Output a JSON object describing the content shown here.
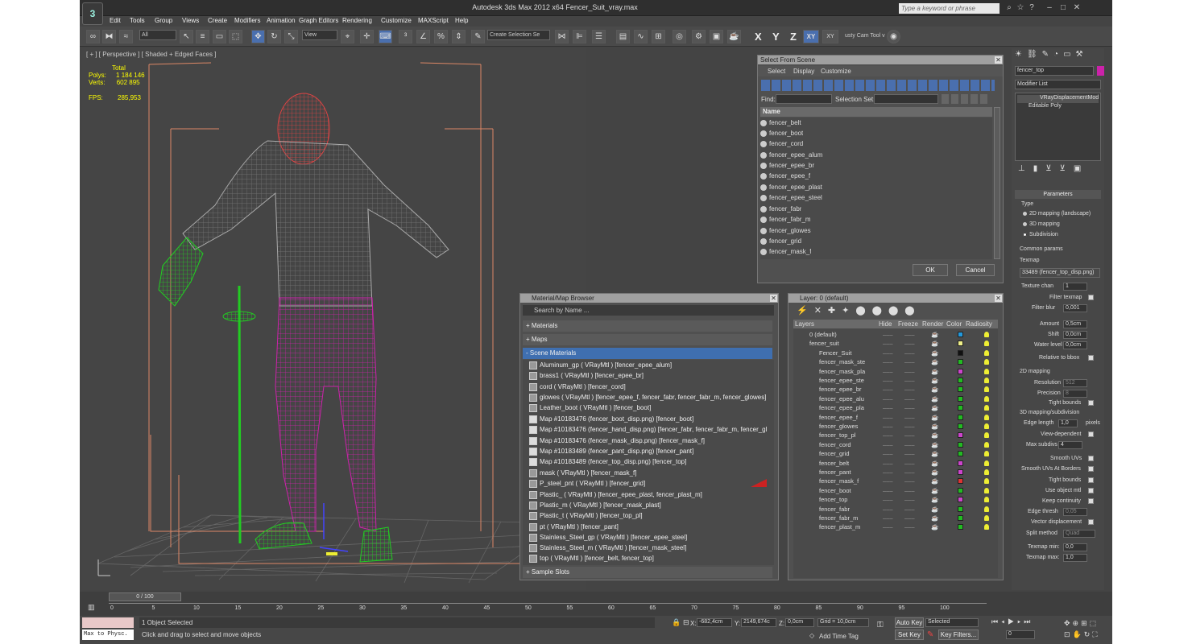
{
  "app": {
    "title": "Autodesk 3ds Max  2012 x64     Fencer_Suit_vray.max",
    "search_placeholder": "Type a keyword or phrase"
  },
  "menu": [
    "Edit",
    "Tools",
    "Group",
    "Views",
    "Create",
    "Modifiers",
    "Animation",
    "Graph Editors",
    "Rendering",
    "Customize",
    "MAXScript",
    "Help"
  ],
  "toolbar": {
    "filter": "All",
    "refcoord": "View",
    "named_sel": "Create Selection Se",
    "axes": [
      "X",
      "Y",
      "Z",
      "XY"
    ],
    "plugin": "usty Cam Tool v"
  },
  "viewport": {
    "label": "[ + ] [ Perspective ] [ Shaded + Edged Faces ]",
    "stats": {
      "total_label": "Total",
      "polys_label": "Polys:",
      "polys": "1 184 146",
      "verts_label": "Verts:",
      "verts": "602 895",
      "fps_label": "FPS:",
      "fps": "285,953"
    }
  },
  "select_from_scene": {
    "title": "Select From Scene",
    "menu": [
      "Select",
      "Display",
      "Customize"
    ],
    "find_label": "Find:",
    "selset_label": "Selection Set:",
    "col_name": "Name",
    "items": [
      "fencer_belt",
      "fencer_boot",
      "fencer_cord",
      "fencer_epee_alum",
      "fencer_epee_br",
      "fencer_epee_f",
      "fencer_epee_plast",
      "fencer_epee_steel",
      "fencer_fabr",
      "fencer_fabr_m",
      "fencer_glowes",
      "fencer_grid",
      "fencer_mask_f"
    ],
    "ok": "OK",
    "cancel": "Cancel"
  },
  "material_browser": {
    "title": "Material/Map Browser",
    "search": "Search by Name ...",
    "sections": [
      "+ Materials",
      "+ Maps",
      "- Scene Materials",
      "+ Sample Slots"
    ],
    "materials": [
      "Aluminum_gp  ( VRayMtl )  [fencer_epee_alum]",
      "brass1  ( VRayMtl )  [fencer_epee_br]",
      "cord  ( VRayMtl )  [fencer_cord]",
      "glowes  ( VRayMtl )  [fencer_epee_f, fencer_fabr, fencer_fabr_m, fencer_glowes]",
      "Leather_boot  ( VRayMtl )  [fencer_boot]",
      "Map #10183476 (fencer_boot_disp.png)  [fencer_boot]",
      "Map #10183476 (fencer_hand_disp.png)  [fencer_fabr, fencer_fabr_m, fencer_gl...",
      "Map #10183476 (fencer_mask_disp.png)  [fencer_mask_f]",
      "Map #10183489 (fencer_pant_disp.png)  [fencer_pant]",
      "Map #10183489 (fencer_top_disp.png)  [fencer_top]",
      "mask  ( VRayMtl )  [fencer_mask_f]",
      "P_steel_pnt  ( VRayMtl )  [fencer_grid]",
      "Plastic_  ( VRayMtl )  [fencer_epee_plast, fencer_plast_m]",
      "Plastic_m  ( VRayMtl )  [fencer_mask_plast]",
      "Plastic_t  ( VRayMtl )  [fencer_top_pl]",
      "pt  ( VRayMtl )  [fencer_pant]",
      "Stainless_Steel_gp  ( VRayMtl )  [fencer_epee_steel]",
      "Stainless_Steel_m  ( VRayMtl )  [fencer_mask_steel]",
      "top  ( VRayMtl )  [fencer_belt, fencer_top]"
    ]
  },
  "layer_panel": {
    "title": "Layer: 0 (default)",
    "headers": [
      "Layers",
      "Hide",
      "Freeze",
      "Render",
      "Color",
      "Radiosity"
    ],
    "rows": [
      {
        "name": "0 (default)",
        "color": "#2299dd"
      },
      {
        "name": "fencer_suit",
        "color": "#eeee88"
      },
      {
        "name": "Fencer_Suit",
        "color": "#111111"
      },
      {
        "name": "fencer_mask_ste",
        "color": "#22bb22"
      },
      {
        "name": "fencer_mask_pla",
        "color": "#cc44cc"
      },
      {
        "name": "fencer_epee_ste",
        "color": "#22bb22"
      },
      {
        "name": "fencer_epee_br",
        "color": "#22bb22"
      },
      {
        "name": "fencer_epee_alu",
        "color": "#22bb22"
      },
      {
        "name": "fencer_epee_pla",
        "color": "#22bb22"
      },
      {
        "name": "fencer_epee_f",
        "color": "#22bb22"
      },
      {
        "name": "fencer_glowes",
        "color": "#22bb22"
      },
      {
        "name": "fencer_top_pl",
        "color": "#cc44cc"
      },
      {
        "name": "fencer_cord",
        "color": "#22bb22"
      },
      {
        "name": "fencer_grid",
        "color": "#22bb22"
      },
      {
        "name": "fencer_belt",
        "color": "#cc44cc"
      },
      {
        "name": "fencer_pant",
        "color": "#cc44cc"
      },
      {
        "name": "fencer_mask_f",
        "color": "#dd3333"
      },
      {
        "name": "fencer_boot",
        "color": "#22bb22"
      },
      {
        "name": "fencer_top",
        "color": "#cc44cc"
      },
      {
        "name": "fencer_fabr",
        "color": "#22bb22"
      },
      {
        "name": "fencer_fabr_m",
        "color": "#22bb22"
      },
      {
        "name": "fencer_plast_m",
        "color": "#22bb22"
      }
    ]
  },
  "command_panel": {
    "object_name": "fencer_top",
    "modifier_list": "Modifier List",
    "stack": [
      "VRayDisplacementMod",
      "Editable Poly"
    ],
    "rollout": "Parameters",
    "type_label": "Type",
    "types": [
      "2D mapping (landscape)",
      "3D mapping",
      "Subdivision"
    ],
    "common": "Common params",
    "texmap_label": "Texmap",
    "texmap": "33489 (fencer_top_disp.png)",
    "texture_chan": "1",
    "filter_texmap": "Filter texmap",
    "filter_blur": "0,001",
    "amount": "0,5cm",
    "shift": "0,0cm",
    "water_level": "0,0cm",
    "relative_bbox": "Relative to bbox",
    "mapping2d": "2D mapping",
    "resolution": "512",
    "precision": "8",
    "tight_bounds": "Tight bounds",
    "mapping3d": "3D mapping/subdivision",
    "edge_length": "1,0",
    "pixels": "pixels",
    "view_dependent": "View-dependent",
    "max_subdivs": "4",
    "smooth_uvs": "Smooth UVs",
    "smooth_uvs_borders": "Smooth UVs At Borders",
    "tight_bounds2": "Tight bounds",
    "use_object_mtl": "Use object mtl",
    "keep_continuity": "Keep continuity",
    "edge_thresh": "0,05",
    "vector_disp": "Vector displacement",
    "split_method": "Quad",
    "texmap_min": "0,0",
    "texmap_max": "1,0",
    "labels": {
      "tc": "Texture chan",
      "fb": "Filter blur",
      "amt": "Amount",
      "sh": "Shift",
      "wl": "Water level",
      "res": "Resolution",
      "prec": "Precision",
      "el": "Edge length",
      "ms": "Max subdivs",
      "et": "Edge thresh",
      "sm": "Split method",
      "tmin": "Texmap min:",
      "tmax": "Texmap max:"
    }
  },
  "timeline": {
    "frame": "0 / 100",
    "ticks": [
      "0",
      "5",
      "10",
      "15",
      "20",
      "25",
      "30",
      "35",
      "40",
      "45",
      "50",
      "55",
      "60",
      "65",
      "70",
      "75",
      "80",
      "85",
      "90",
      "95",
      "100"
    ]
  },
  "status": {
    "selected": "1 Object Selected",
    "prompt": "Click and drag to select and move objects",
    "script": "Max to Physc.",
    "x": "-682,4cm",
    "y": "2149,674c",
    "z": "0,0cm",
    "grid": "Grid = 10,0cm",
    "add_time_tag": "Add Time Tag",
    "auto_key": "Auto Key",
    "selected_mode": "Selected",
    "set_key": "Set Key",
    "key_filters": "Key Filters...",
    "frame": "0"
  }
}
